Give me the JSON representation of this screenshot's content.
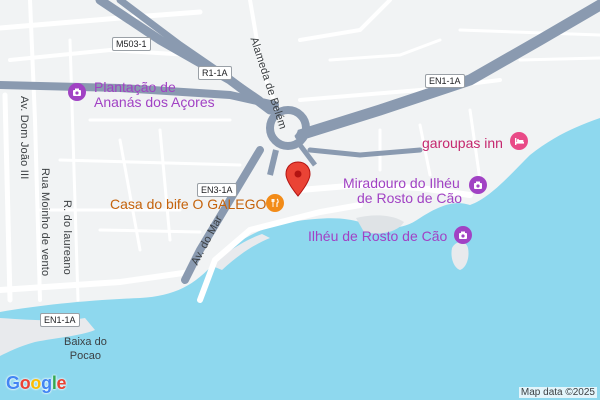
{
  "map": {
    "colors": {
      "land": "#f1f3f4",
      "water": "#8ed8ee",
      "highway": "#8a9ab0",
      "road": "#ffffff",
      "poi": "#a142c4",
      "food": "#c5630c",
      "hotel": "#c5276e",
      "pin": "#ea4335"
    },
    "pois": [
      {
        "name": "Plantação de",
        "name2": "Ananás dos Açores",
        "icon": "camera-icon"
      },
      {
        "name": "Miradouro do Ilhéu",
        "name2": "de Rosto de Cão",
        "icon": "camera-icon"
      },
      {
        "name": "Ilhéu de Rosto de Cão",
        "icon": "camera-icon"
      },
      {
        "name": "Casa do bife O GALEGO",
        "icon": "fork-knife-icon"
      },
      {
        "name": "garoupas inn",
        "icon": "bed-icon"
      }
    ],
    "streets": {
      "alameda": "Alameda de Belém",
      "dom_joao": "Av. Dom João III",
      "moinho": "Rua Moinho de vento",
      "laureano": "R. do laureano",
      "av_mar": "Av. do Mar"
    },
    "shields": {
      "m503": "M503-1",
      "r1": "R1-1A",
      "en1_east": "EN1-1A",
      "en3": "EN3-1A",
      "en1_west": "EN1-1A"
    },
    "locality": {
      "line1": "Baixa do",
      "line2": "Pocao"
    },
    "attribution": "Map data ©2025",
    "logo": {
      "g1": "G",
      "o1": "o",
      "o2": "o",
      "g2": "g",
      "l": "l",
      "e": "e"
    }
  }
}
